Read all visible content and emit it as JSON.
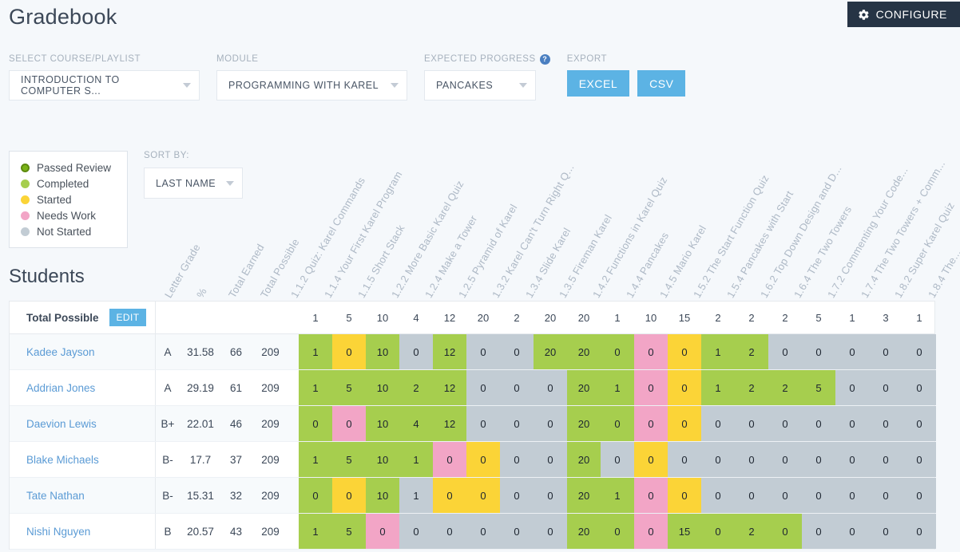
{
  "header": {
    "title": "Gradebook",
    "configure_label": "CONFIGURE",
    "configure_icon": "gear-icon"
  },
  "controls": {
    "course": {
      "label": "SELECT COURSE/PLAYLIST",
      "value": "INTRODUCTION TO COMPUTER S..."
    },
    "module": {
      "label": "MODULE",
      "value": "PROGRAMMING WITH KAREL"
    },
    "expected_progress": {
      "label": "EXPECTED PROGRESS",
      "value": "PANCAKES",
      "help_icon": "help-icon",
      "help_glyph": "?"
    },
    "export": {
      "label": "EXPORT",
      "excel_label": "EXCEL",
      "csv_label": "CSV"
    },
    "sort_by": {
      "label": "SORT BY:",
      "value": "LAST NAME"
    }
  },
  "legend": {
    "items": [
      {
        "label": "Passed Review",
        "color": "#7ab317"
      },
      {
        "label": "Completed",
        "color": "#a6ce4e"
      },
      {
        "label": "Started",
        "color": "#fbd437"
      },
      {
        "label": "Needs Work",
        "color": "#f2a5c6"
      },
      {
        "label": "Not Started",
        "color": "#c2ccd4"
      }
    ]
  },
  "students_title": "Students",
  "table": {
    "meta_headers": [
      "Letter Grade",
      "%",
      "Total Earned",
      "Total Possible"
    ],
    "assignment_headers": [
      "1.1.2 Quiz: Karel Commands",
      "1.1.4 Your First Karel Program",
      "1.1.5 Short Stack",
      "1.2.2 More Basic Karel Quiz",
      "1.2.4 Make a Tower",
      "1.2.5 Pyramid of Karel",
      "1.3.2 Karel Can't Turn Right Q...",
      "1.3.4 Slide Karel",
      "1.3.5 Fireman Karel",
      "1.4.2 Functions in Karel Quiz",
      "1.4.4 Pancakes",
      "1.4.5 Mario Karel",
      "1.5.2 The Start Function Quiz",
      "1.5.4 Pancakes with Start",
      "1.6.2 Top Down Design and D...",
      "1.6.4 The Two Towers",
      "1.7.2 Commenting Your Code...",
      "1.7.4 The Two Towers + Comm...",
      "1.8.2 Super Karel Quiz",
      "1.8.4 The..."
    ],
    "total_possible_row": {
      "label": "Total Possible",
      "edit_label": "EDIT",
      "values": [
        1,
        5,
        10,
        4,
        12,
        20,
        2,
        20,
        20,
        1,
        10,
        15,
        2,
        2,
        2,
        5,
        1,
        3,
        1
      ]
    },
    "rows": [
      {
        "name": "Kadee Jayson",
        "letter_grade": "A",
        "percent": "31.58",
        "earned": "66",
        "possible": "209",
        "cells": [
          {
            "v": "1",
            "s": "completed"
          },
          {
            "v": "0",
            "s": "started"
          },
          {
            "v": "10",
            "s": "completed"
          },
          {
            "v": "0",
            "s": "notstarted"
          },
          {
            "v": "12",
            "s": "completed"
          },
          {
            "v": "0",
            "s": "notstarted"
          },
          {
            "v": "0",
            "s": "notstarted"
          },
          {
            "v": "20",
            "s": "completed"
          },
          {
            "v": "20",
            "s": "completed"
          },
          {
            "v": "0",
            "s": "completed"
          },
          {
            "v": "0",
            "s": "needswork"
          },
          {
            "v": "0",
            "s": "started"
          },
          {
            "v": "1",
            "s": "completed"
          },
          {
            "v": "2",
            "s": "completed"
          },
          {
            "v": "0",
            "s": "notstarted"
          },
          {
            "v": "0",
            "s": "notstarted"
          },
          {
            "v": "0",
            "s": "notstarted"
          },
          {
            "v": "0",
            "s": "notstarted"
          },
          {
            "v": "0",
            "s": "notstarted"
          }
        ]
      },
      {
        "name": "Addrian Jones",
        "letter_grade": "A",
        "percent": "29.19",
        "earned": "61",
        "possible": "209",
        "cells": [
          {
            "v": "1",
            "s": "completed"
          },
          {
            "v": "5",
            "s": "completed"
          },
          {
            "v": "10",
            "s": "completed"
          },
          {
            "v": "2",
            "s": "completed"
          },
          {
            "v": "12",
            "s": "completed"
          },
          {
            "v": "0",
            "s": "notstarted"
          },
          {
            "v": "0",
            "s": "notstarted"
          },
          {
            "v": "0",
            "s": "notstarted"
          },
          {
            "v": "20",
            "s": "completed"
          },
          {
            "v": "1",
            "s": "completed"
          },
          {
            "v": "0",
            "s": "needswork"
          },
          {
            "v": "0",
            "s": "started"
          },
          {
            "v": "1",
            "s": "completed"
          },
          {
            "v": "2",
            "s": "completed"
          },
          {
            "v": "2",
            "s": "completed"
          },
          {
            "v": "5",
            "s": "completed"
          },
          {
            "v": "0",
            "s": "notstarted"
          },
          {
            "v": "0",
            "s": "notstarted"
          },
          {
            "v": "0",
            "s": "notstarted"
          }
        ]
      },
      {
        "name": "Daevion Lewis",
        "letter_grade": "B+",
        "percent": "22.01",
        "earned": "46",
        "possible": "209",
        "cells": [
          {
            "v": "0",
            "s": "completed"
          },
          {
            "v": "0",
            "s": "needswork"
          },
          {
            "v": "10",
            "s": "completed"
          },
          {
            "v": "4",
            "s": "completed"
          },
          {
            "v": "12",
            "s": "completed"
          },
          {
            "v": "0",
            "s": "notstarted"
          },
          {
            "v": "0",
            "s": "notstarted"
          },
          {
            "v": "0",
            "s": "notstarted"
          },
          {
            "v": "20",
            "s": "completed"
          },
          {
            "v": "0",
            "s": "completed"
          },
          {
            "v": "0",
            "s": "needswork"
          },
          {
            "v": "0",
            "s": "started"
          },
          {
            "v": "0",
            "s": "notstarted"
          },
          {
            "v": "0",
            "s": "notstarted"
          },
          {
            "v": "0",
            "s": "notstarted"
          },
          {
            "v": "0",
            "s": "notstarted"
          },
          {
            "v": "0",
            "s": "notstarted"
          },
          {
            "v": "0",
            "s": "notstarted"
          },
          {
            "v": "0",
            "s": "notstarted"
          }
        ]
      },
      {
        "name": "Blake Michaels",
        "letter_grade": "B-",
        "percent": "17.7",
        "earned": "37",
        "possible": "209",
        "cells": [
          {
            "v": "1",
            "s": "completed"
          },
          {
            "v": "5",
            "s": "completed"
          },
          {
            "v": "10",
            "s": "completed"
          },
          {
            "v": "1",
            "s": "completed"
          },
          {
            "v": "0",
            "s": "needswork"
          },
          {
            "v": "0",
            "s": "started"
          },
          {
            "v": "0",
            "s": "notstarted"
          },
          {
            "v": "0",
            "s": "notstarted"
          },
          {
            "v": "20",
            "s": "completed"
          },
          {
            "v": "0",
            "s": "notstarted"
          },
          {
            "v": "0",
            "s": "started"
          },
          {
            "v": "0",
            "s": "notstarted"
          },
          {
            "v": "0",
            "s": "notstarted"
          },
          {
            "v": "0",
            "s": "notstarted"
          },
          {
            "v": "0",
            "s": "notstarted"
          },
          {
            "v": "0",
            "s": "notstarted"
          },
          {
            "v": "0",
            "s": "notstarted"
          },
          {
            "v": "0",
            "s": "notstarted"
          },
          {
            "v": "0",
            "s": "notstarted"
          }
        ]
      },
      {
        "name": "Tate Nathan",
        "letter_grade": "B-",
        "percent": "15.31",
        "earned": "32",
        "possible": "209",
        "cells": [
          {
            "v": "0",
            "s": "completed"
          },
          {
            "v": "0",
            "s": "started"
          },
          {
            "v": "10",
            "s": "completed"
          },
          {
            "v": "1",
            "s": "notstarted"
          },
          {
            "v": "0",
            "s": "started"
          },
          {
            "v": "0",
            "s": "started"
          },
          {
            "v": "0",
            "s": "notstarted"
          },
          {
            "v": "0",
            "s": "notstarted"
          },
          {
            "v": "20",
            "s": "completed"
          },
          {
            "v": "1",
            "s": "completed"
          },
          {
            "v": "0",
            "s": "needswork"
          },
          {
            "v": "0",
            "s": "started"
          },
          {
            "v": "0",
            "s": "notstarted"
          },
          {
            "v": "0",
            "s": "notstarted"
          },
          {
            "v": "0",
            "s": "notstarted"
          },
          {
            "v": "0",
            "s": "notstarted"
          },
          {
            "v": "0",
            "s": "notstarted"
          },
          {
            "v": "0",
            "s": "notstarted"
          },
          {
            "v": "0",
            "s": "notstarted"
          }
        ]
      },
      {
        "name": "Nishi Nguyen",
        "letter_grade": "B",
        "percent": "20.57",
        "earned": "43",
        "possible": "209",
        "cells": [
          {
            "v": "1",
            "s": "completed"
          },
          {
            "v": "5",
            "s": "completed"
          },
          {
            "v": "0",
            "s": "needswork"
          },
          {
            "v": "0",
            "s": "notstarted"
          },
          {
            "v": "0",
            "s": "notstarted"
          },
          {
            "v": "0",
            "s": "notstarted"
          },
          {
            "v": "0",
            "s": "notstarted"
          },
          {
            "v": "0",
            "s": "notstarted"
          },
          {
            "v": "20",
            "s": "completed"
          },
          {
            "v": "0",
            "s": "completed"
          },
          {
            "v": "0",
            "s": "needswork"
          },
          {
            "v": "15",
            "s": "completed"
          },
          {
            "v": "0",
            "s": "completed"
          },
          {
            "v": "2",
            "s": "completed"
          },
          {
            "v": "0",
            "s": "completed"
          },
          {
            "v": "0",
            "s": "notstarted"
          },
          {
            "v": "0",
            "s": "notstarted"
          },
          {
            "v": "0",
            "s": "notstarted"
          },
          {
            "v": "0",
            "s": "notstarted"
          }
        ]
      }
    ]
  },
  "colors": {
    "passed": "#7ab317",
    "completed": "#a6ce4e",
    "started": "#fbd437",
    "needswork": "#f2a5c6",
    "notstarted": "#c2ccd4",
    "accent_blue": "#5cb3e4",
    "dark": "#263445"
  }
}
